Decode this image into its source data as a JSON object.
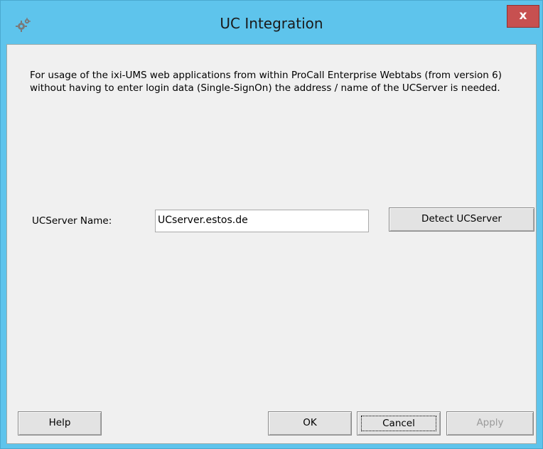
{
  "window": {
    "title": "UC Integration",
    "close_label": "x",
    "accent": "#5ec4ec",
    "close_color": "#c75050"
  },
  "content": {
    "description": "For usage of the ixi-UMS web applications from within ProCall Enterprise Webtabs (from version 6) without having to enter login data (Single-SignOn) the address / name of the UCServer is needed.",
    "server_label": "UCServer Name:",
    "server_value": "UCserver.estos.de",
    "detect_label": "Detect UCServer"
  },
  "footer": {
    "help_label": "Help",
    "ok_label": "OK",
    "cancel_label": "Cancel",
    "apply_label": "Apply"
  }
}
